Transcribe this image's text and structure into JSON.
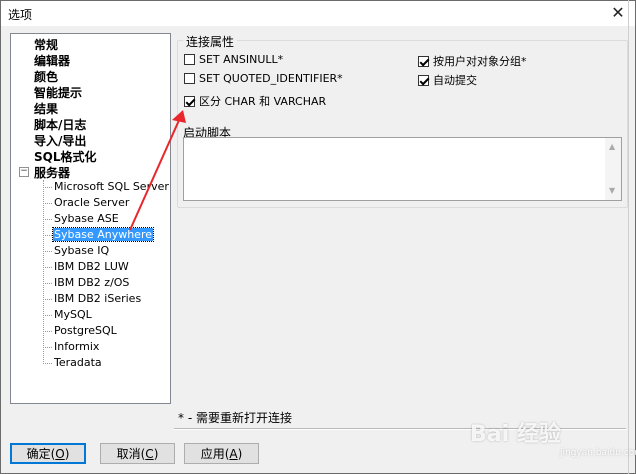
{
  "window": {
    "title": "选项",
    "close_glyph": "✕"
  },
  "tree": {
    "top_items": [
      "常规",
      "编辑器",
      "颜色",
      "智能提示",
      "结果",
      "脚本/日志",
      "导入/导出",
      "SQL格式化"
    ],
    "server_node": {
      "label": "服务器",
      "expander": "−"
    },
    "servers": [
      "Microsoft SQL Server",
      "Oracle Server",
      "Sybase ASE",
      "Sybase Anywhere",
      "Sybase IQ",
      "IBM DB2 LUW",
      "IBM DB2 z/OS",
      "IBM DB2 iSeries",
      "MySQL",
      "PostgreSQL",
      "Informix",
      "Teradata"
    ],
    "selected": "Sybase Anywhere"
  },
  "connection": {
    "group_title": "连接属性",
    "options": [
      {
        "label": "SET ANSINULL*",
        "checked": false
      },
      {
        "label": "SET QUOTED_IDENTIFIER*",
        "checked": false
      },
      {
        "label": "区分 CHAR 和 VARCHAR",
        "checked": true
      },
      {
        "label": "按用户对对象分组*",
        "checked": true
      },
      {
        "label": "自动提交",
        "checked": true
      }
    ],
    "startup_label": "启动脚本",
    "startup_value": ""
  },
  "footer": {
    "note": "* - 需要重新打开连接"
  },
  "buttons": {
    "ok": {
      "text": "确定(",
      "key": "O",
      "close": ")"
    },
    "cancel": {
      "text": "取消(",
      "key": "C",
      "close": ")"
    },
    "apply": {
      "text": "应用(",
      "key": "A",
      "close": ")"
    }
  },
  "annotation": {
    "color": "#e8262b"
  },
  "watermark": {
    "text": "Bai 经验",
    "sub": "jingyan.baidu.com"
  }
}
